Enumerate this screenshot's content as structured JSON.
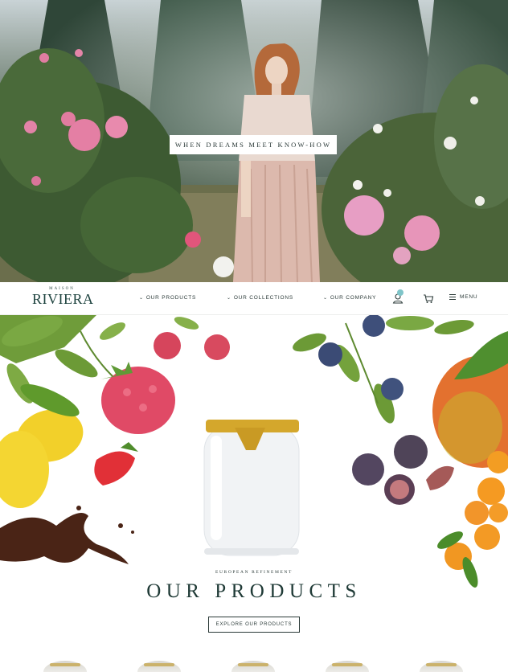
{
  "hero": {
    "tagline": "WHEN DREAMS MEET KNOW-HOW"
  },
  "nav": {
    "logo_small": "MAISON",
    "logo_big": "RIVIERA",
    "links": [
      {
        "label": "OUR PRODUCTS",
        "icon": "chevron-down-icon"
      },
      {
        "label": "OUR COLLECTIONS",
        "icon": "chevron-down-icon"
      },
      {
        "label": "OUR COMPANY",
        "icon": "chevron-down-icon"
      }
    ],
    "icons": [
      "account-icon",
      "cart-icon"
    ],
    "menu_label": "MENU",
    "badge_color": "#7fc5c9"
  },
  "products": {
    "eyebrow": "EUROPEAN REFINEMENT",
    "title": "OUR PRODUCTS",
    "button_label": "EXPLORE OUR PRODUCTS"
  },
  "colors": {
    "brand_dark": "#1f3a36",
    "gold_lid": "#d4a72c"
  }
}
